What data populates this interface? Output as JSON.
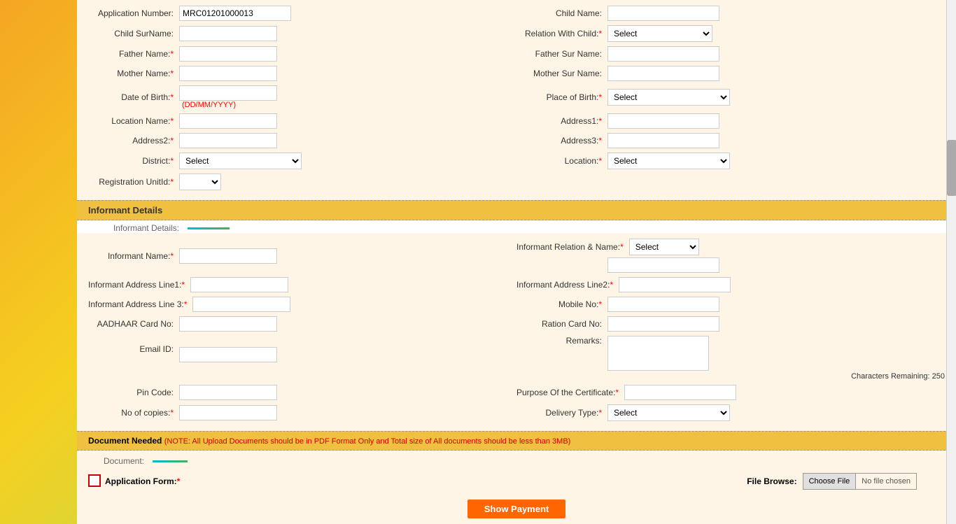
{
  "form": {
    "top": {
      "application_number_label": "Application Number:",
      "application_number_value": "MRC01201000013",
      "child_name_label": "Child Name:",
      "child_surname_label": "Child SurName:",
      "relation_with_child_label": "Relation With Child:",
      "father_name_label": "Father Name:",
      "father_sur_name_label": "Father Sur Name:",
      "mother_name_label": "Mother Name:",
      "mother_sur_name_label": "Mother Sur Name:",
      "date_of_birth_label": "Date of Birth:",
      "date_of_birth_hint": "(DD/MM/YYYY)",
      "place_of_birth_label": "Place of Birth:",
      "location_name_label": "Location Name:",
      "address1_label": "Address1:",
      "address2_label": "Address2:",
      "address3_label": "Address3:",
      "district_label": "District:",
      "location_label": "Location:",
      "registration_unit_label": "Registration UnitId:",
      "select_placeholder": "Select",
      "req_marker": "*"
    },
    "informant": {
      "section_title": "Informant Details",
      "subheader_label": "Informant Details:",
      "informant_name_label": "Informant Name:",
      "informant_relation_label": "Informant Relation & Name:",
      "informant_addr1_label": "Informant Address Line1:",
      "informant_addr2_label": "Informant Address Line2:",
      "informant_addr3_label": "Informant Address Line 3:",
      "mobile_no_label": "Mobile No:",
      "aadhaar_label": "AADHAAR Card No:",
      "ration_label": "Ration Card No:",
      "email_label": "Email ID:",
      "remarks_label": "Remarks:",
      "chars_remaining": "Characters Remaining: 250",
      "pin_code_label": "Pin Code:",
      "purpose_label": "Purpose Of the Certificate:",
      "no_of_copies_label": "No of copies:",
      "delivery_type_label": "Delivery Type:",
      "req_marker": "*"
    },
    "document": {
      "section_title": "Document Needed",
      "note": "(NOTE: All Upload Documents should be in PDF Format Only and Total size of All documents should be less than 3MB)",
      "subheader_label": "Document:",
      "application_form_label": "Application Form:",
      "file_browse_label": "File Browse:",
      "choose_file_btn": "Choose File",
      "no_file_text": "No file chosen",
      "req_marker": "*"
    },
    "buttons": {
      "show_payment": "Show Payment"
    },
    "select_options": {
      "select": "Select"
    }
  }
}
